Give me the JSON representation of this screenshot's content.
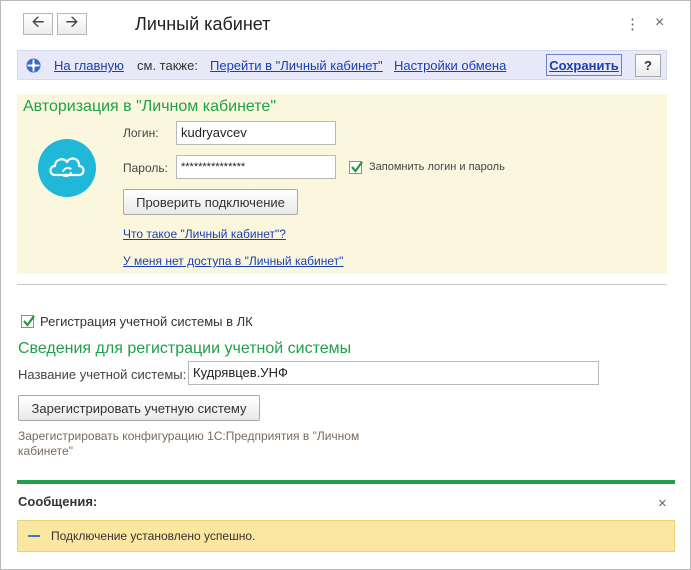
{
  "window": {
    "title": "Личный кабинет"
  },
  "nav": {
    "back_icon": "arrow-left-icon",
    "forward_icon": "arrow-right-icon"
  },
  "toolbar": {
    "home_link": "На главную",
    "see_also": "см. также:",
    "goto_link": "Перейти в \"Личный кабинет\"",
    "exchange_link": "Настройки обмена",
    "save_label": "Сохранить",
    "help_label": "?"
  },
  "auth": {
    "title": "Авторизация в \"Личном кабинете\"",
    "login_label": "Логин:",
    "login_value": "kudryavcev",
    "password_label": "Пароль:",
    "password_value": "***************",
    "remember_label": "Запомнить логин и пароль",
    "remember_checked": true,
    "check_button": "Проверить подключение",
    "what_is_link": "Что такое \"Личный кабинет\"?",
    "no_access_link": "У меня нет доступа в \"Личный кабинет\""
  },
  "registration": {
    "checkbox_label": "Регистрация учетной системы в ЛК",
    "checkbox_checked": true,
    "section_title": "Сведения для регистрации учетной системы",
    "name_label": "Название учетной системы:",
    "name_value": "Кудрявцев.УНФ",
    "register_button": "Зарегистрировать учетную систему",
    "hint": "Зарегистрировать конфигурацию 1С:Предприятия в \"Личном кабинете\""
  },
  "messages": {
    "title": "Сообщения:",
    "text": "Подключение установлено успешно."
  },
  "colors": {
    "accent_green": "#1fa04a",
    "link_blue": "#1a3fb3",
    "cloud_cyan": "#1fb8d8",
    "panel_yellow": "#fbf7df"
  }
}
